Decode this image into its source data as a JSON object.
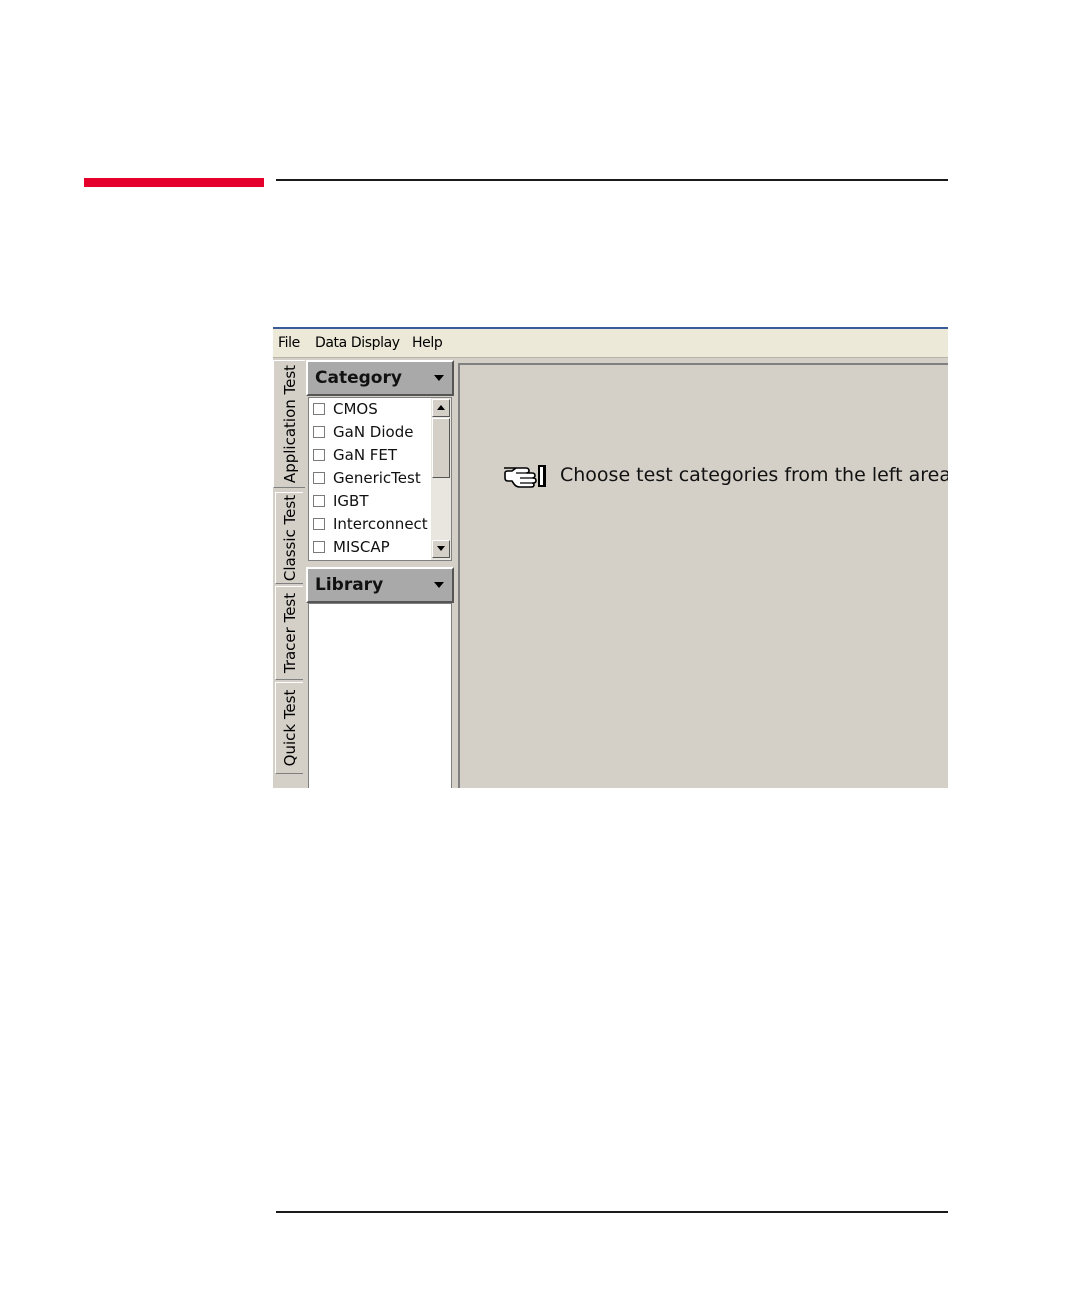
{
  "menu": {
    "items": [
      "File",
      "Data Display",
      "Help"
    ]
  },
  "tabs": [
    "Application Test",
    "Classic Test",
    "Tracer Test",
    "Quick Test"
  ],
  "active_tab": "Application Test",
  "category": {
    "title": "Category",
    "items": [
      "CMOS",
      "GaN Diode",
      "GaN FET",
      "GenericTest",
      "IGBT",
      "Interconnect",
      "MISCAP"
    ]
  },
  "library": {
    "title": "Library"
  },
  "main": {
    "hint_icon": "pointing-hand-icon",
    "hint": "Choose test categories from the left area."
  },
  "colors": {
    "accent_red": "#e4002b",
    "window_bg": "#d4d0c8",
    "panel_header": "#a9a9a9"
  }
}
